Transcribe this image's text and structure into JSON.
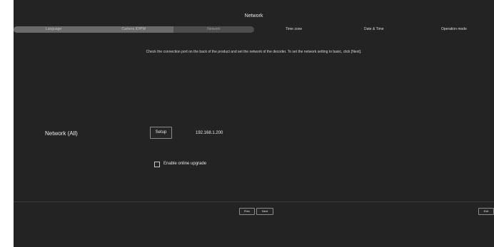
{
  "header": {
    "title": "Network"
  },
  "steps": [
    {
      "label": "Language",
      "state": "done"
    },
    {
      "label": "Camera ID/PW",
      "state": "done"
    },
    {
      "label": "Network",
      "state": "current"
    },
    {
      "label": "Time zone",
      "state": "pending"
    },
    {
      "label": "Date & Time",
      "state": "pending"
    },
    {
      "label": "Operation mode",
      "state": "pending"
    }
  ],
  "main": {
    "instruction": "Check the connection port on the back of the product and set the network of the decoder. To set the network setting to basic, click [Next].",
    "network_label": "Network (All)",
    "setup_label": "Setup",
    "ip_address": "192.168.1.200",
    "online_upgrade_label": "Enable online upgrade",
    "online_upgrade_checked": false
  },
  "footer": {
    "prev_label": "Prev",
    "next_label": "Next",
    "exit_label": "Exit"
  },
  "colors": {
    "background": "#232323",
    "step_done": "#6a6a6a",
    "step_current": "#4d4d4d",
    "border": "#8a8a8a"
  }
}
